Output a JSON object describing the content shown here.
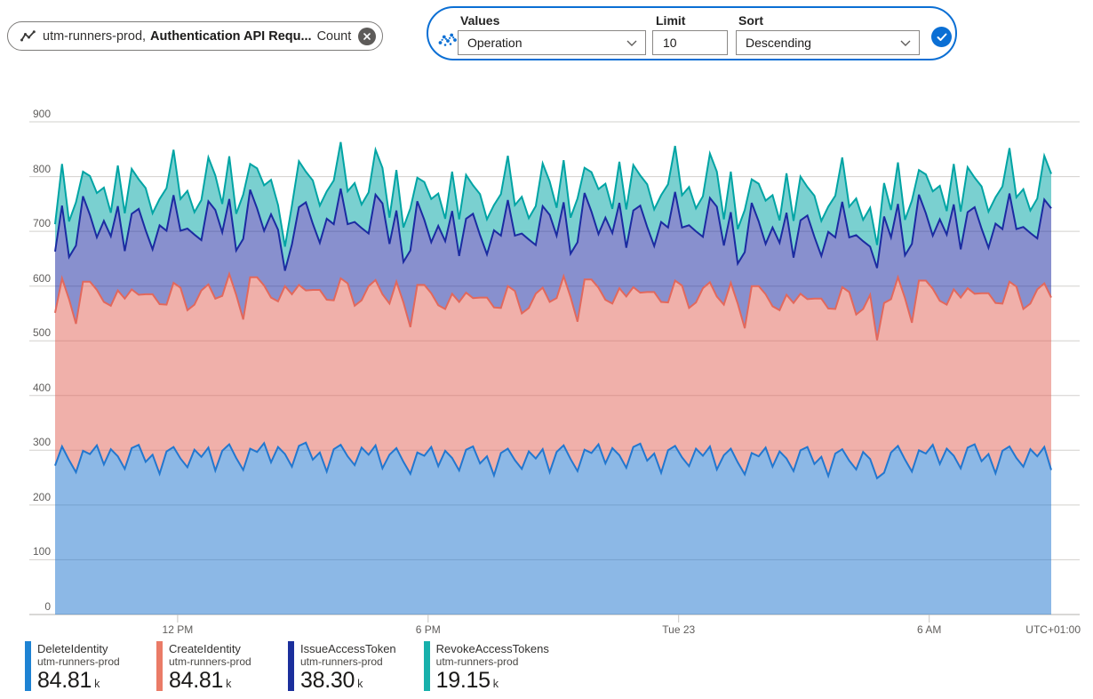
{
  "colors": {
    "accent": "#0b6fd4",
    "grid": "#d2d0ce",
    "axis_text": "#5f5d5b"
  },
  "header": {
    "metric_pill": {
      "resource": "utm-runners-prod,",
      "metric": "Authentication API Requ...",
      "aggregation": "Count"
    },
    "split_control": {
      "values_label": "Values",
      "values_value": "Operation",
      "limit_label": "Limit",
      "limit_value": "10",
      "sort_label": "Sort",
      "sort_value": "Descending"
    }
  },
  "chart_data": {
    "type": "area",
    "stacked": true,
    "grid": true,
    "legend_position": "bottom",
    "ylim": [
      0,
      900
    ],
    "y_ticks": [
      0,
      100,
      200,
      300,
      400,
      500,
      600,
      700,
      800,
      900
    ],
    "x_ticks": [
      {
        "label": "12 PM",
        "frac": 0.123
      },
      {
        "label": "6 PM",
        "frac": 0.3745
      },
      {
        "label": "Tue 23",
        "frac": 0.626
      },
      {
        "label": "6 AM",
        "frac": 0.8775
      }
    ],
    "timezone_label": "UTC+01:00",
    "series": [
      {
        "name": "DeleteIdentity",
        "resource": "utm-runners-prod",
        "total_display": "84.81",
        "unit": "k",
        "color": "#2277cf",
        "legend_color": "#1e83d3",
        "values": [
          272,
          307,
          282,
          260,
          299,
          293,
          309,
          274,
          302,
          289,
          266,
          304,
          310,
          279,
          292,
          257,
          298,
          306,
          285,
          269,
          301,
          288,
          305,
          263,
          299,
          311,
          286,
          264,
          303,
          297,
          313,
          278,
          306,
          293,
          270,
          308,
          314,
          283,
          296,
          261,
          302,
          310,
          289,
          273,
          305,
          292,
          309,
          267,
          292,
          304,
          279,
          257,
          296,
          290,
          306,
          271,
          299,
          286,
          263,
          301,
          307,
          276,
          289,
          254,
          295,
          303,
          282,
          266,
          298,
          285,
          302,
          260,
          297,
          309,
          284,
          262,
          301,
          295,
          311,
          276,
          304,
          291,
          268,
          306,
          312,
          281,
          294,
          259,
          300,
          308,
          287,
          271,
          303,
          290,
          307,
          265,
          291,
          303,
          278,
          256,
          295,
          289,
          305,
          270,
          298,
          285,
          262,
          300,
          306,
          275,
          288,
          253,
          294,
          302,
          281,
          265,
          297,
          284,
          249,
          259,
          296,
          308,
          283,
          261,
          300,
          294,
          310,
          275,
          303,
          290,
          267,
          305,
          311,
          280,
          293,
          258,
          299,
          307,
          286,
          270,
          302,
          289,
          306,
          264
        ]
      },
      {
        "name": "CreateIdentity",
        "resource": "utm-runners-prod",
        "total_display": "84.81",
        "unit": "k",
        "color": "#e2685c",
        "legend_color": "#ea7b67",
        "values": [
          279,
          307,
          294,
          271,
          309,
          315,
          284,
          297,
          262,
          303,
          311,
          290,
          274,
          306,
          293,
          310,
          268,
          300,
          312,
          287,
          265,
          304,
          298,
          314,
          283,
          311,
          298,
          275,
          313,
          319,
          288,
          301,
          266,
          307,
          315,
          294,
          278,
          310,
          297,
          314,
          272,
          304,
          316,
          291,
          269,
          308,
          302,
          318,
          276,
          304,
          291,
          268,
          306,
          312,
          281,
          294,
          259,
          300,
          308,
          287,
          271,
          303,
          290,
          307,
          265,
          297,
          309,
          284,
          262,
          301,
          295,
          311,
          281,
          309,
          296,
          273,
          311,
          317,
          286,
          299,
          264,
          305,
          313,
          292,
          276,
          308,
          295,
          312,
          270,
          302,
          314,
          289,
          267,
          306,
          300,
          316,
          275,
          303,
          290,
          267,
          305,
          311,
          280,
          293,
          258,
          299,
          307,
          286,
          270,
          302,
          289,
          306,
          264,
          296,
          308,
          283,
          261,
          300,
          252,
          310,
          280,
          308,
          295,
          272,
          310,
          316,
          285,
          298,
          263,
          304,
          312,
          291,
          275,
          307,
          294,
          311,
          269,
          301,
          313,
          288,
          266,
          305,
          299,
          315
        ]
      },
      {
        "name": "IssueAccessToken",
        "resource": "utm-runners-prod",
        "total_display": "38.30",
        "unit": "k",
        "color": "#1b2ba1",
        "legend_color": "#1b2f9c",
        "values": [
          112,
          133,
          77,
          143,
          156,
          122,
          96,
          148,
          127,
          154,
          87,
          138,
          157,
          117,
          82,
          144,
          135,
          160,
          104,
          149,
          128,
          92,
          152,
          162,
          116,
          137,
          81,
          147,
          160,
          126,
          100,
          152,
          131,
          28,
          91,
          142,
          161,
          121,
          86,
          148,
          139,
          164,
          108,
          153,
          132,
          96,
          156,
          166,
          109,
          130,
          74,
          140,
          153,
          119,
          93,
          145,
          124,
          151,
          84,
          135,
          154,
          114,
          79,
          141,
          132,
          157,
          101,
          146,
          125,
          89,
          149,
          159,
          114,
          135,
          79,
          145,
          158,
          124,
          98,
          150,
          129,
          156,
          89,
          140,
          159,
          119,
          84,
          146,
          137,
          162,
          106,
          151,
          130,
          94,
          154,
          164,
          108,
          129,
          73,
          139,
          152,
          118,
          92,
          144,
          123,
          150,
          83,
          134,
          153,
          113,
          78,
          140,
          131,
          156,
          100,
          145,
          124,
          88,
          132,
          158,
          113,
          134,
          78,
          144,
          157,
          123,
          97,
          149,
          128,
          155,
          88,
          139,
          158,
          118,
          83,
          145,
          136,
          161,
          105,
          150,
          129,
          93,
          153,
          163
        ]
      },
      {
        "name": "RevokeAccessTokens",
        "resource": "utm-runners-prod",
        "total_display": "19.15",
        "unit": "k",
        "color": "#00a4a4",
        "legend_color": "#17b0ab",
        "values": [
          50,
          76,
          65,
          79,
          45,
          71,
          81,
          61,
          43,
          74,
          69,
          82,
          54,
          77,
          66,
          48,
          78,
          83,
          58,
          69,
          41,
          73,
          80,
          63,
          52,
          78,
          67,
          81,
          47,
          73,
          83,
          63,
          45,
          44,
          71,
          84,
          56,
          79,
          68,
          50,
          80,
          85,
          60,
          71,
          43,
          75,
          82,
          65,
          48,
          74,
          63,
          77,
          43,
          69,
          79,
          59,
          41,
          72,
          67,
          80,
          52,
          75,
          64,
          46,
          76,
          81,
          56,
          67,
          39,
          71,
          78,
          61,
          51,
          77,
          66,
          80,
          46,
          72,
          82,
          62,
          44,
          75,
          70,
          83,
          55,
          78,
          67,
          49,
          79,
          84,
          59,
          70,
          42,
          74,
          81,
          64,
          48,
          74,
          63,
          77,
          43,
          69,
          79,
          59,
          41,
          72,
          67,
          80,
          52,
          75,
          64,
          46,
          76,
          81,
          56,
          67,
          39,
          71,
          42,
          61,
          50,
          76,
          65,
          79,
          45,
          71,
          81,
          61,
          43,
          74,
          69,
          82,
          54,
          77,
          66,
          48,
          78,
          83,
          58,
          69,
          41,
          73,
          80,
          63
        ]
      }
    ]
  }
}
